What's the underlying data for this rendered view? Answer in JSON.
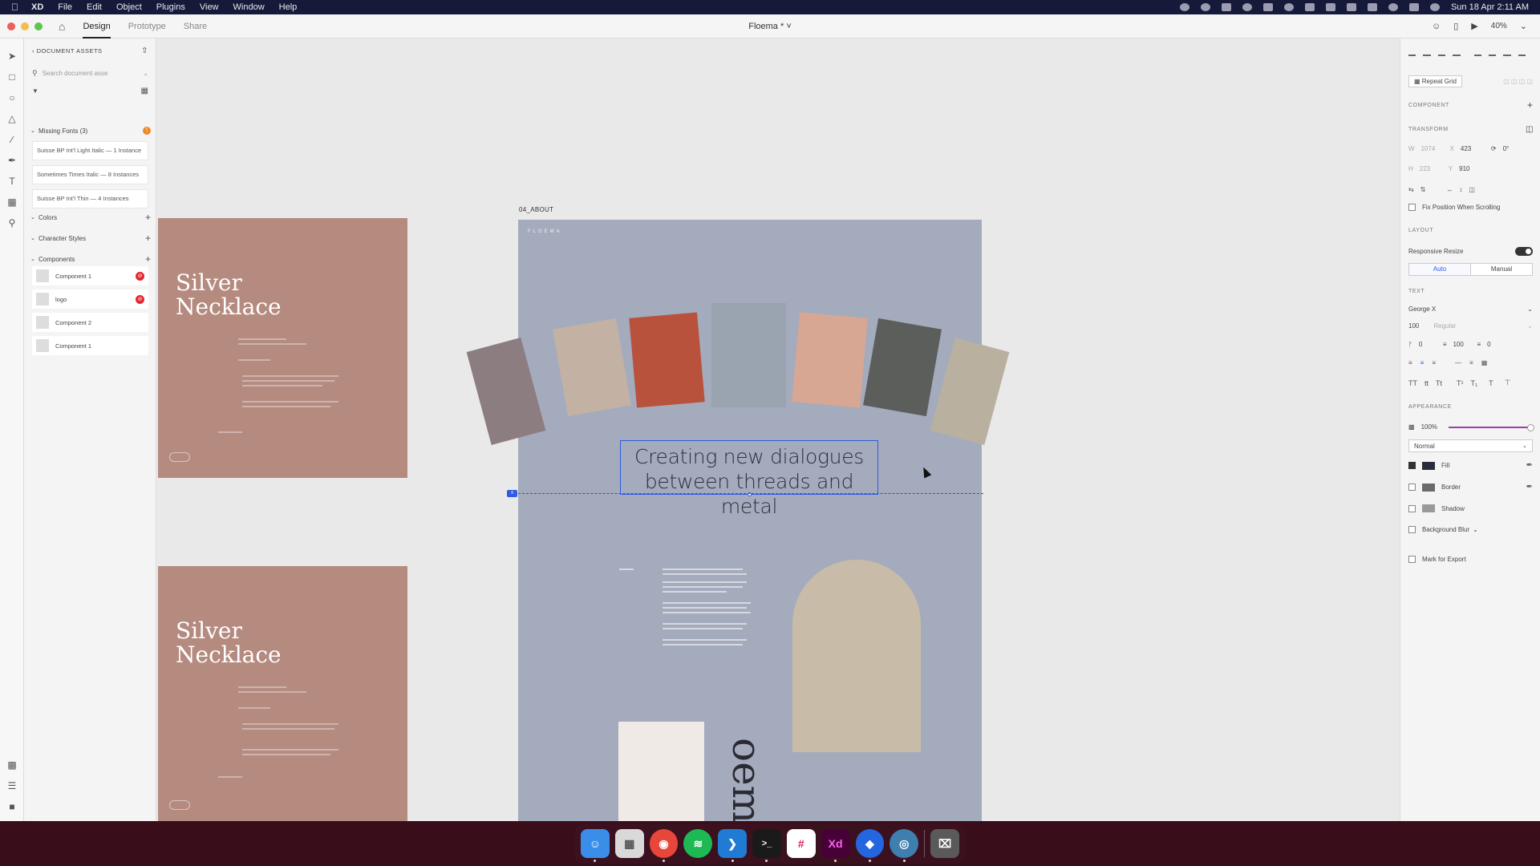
{
  "menubar": {
    "app_name": "XD",
    "items": [
      "File",
      "Edit",
      "Object",
      "Plugins",
      "View",
      "Window",
      "Help"
    ],
    "clock": "Sun 18 Apr  2:11 AM"
  },
  "titlebar": {
    "tabs": [
      {
        "label": "Design",
        "active": true
      },
      {
        "label": "Prototype",
        "active": false
      },
      {
        "label": "Share",
        "active": false
      }
    ],
    "doc_title": "Floema * ˅",
    "zoom": "40%"
  },
  "assets": {
    "header": "DOCUMENT ASSETS",
    "search_placeholder": "Search document asse",
    "missing_fonts": {
      "label": "Missing Fonts (3)",
      "badge": "!",
      "items": [
        "Suisse BP Int'l Light Italic — 1 Instance",
        "Sometimes Times Italic — 8 Instances",
        "Suisse BP Int'l Thin — 4 Instances"
      ]
    },
    "colors_label": "Colors",
    "character_styles_label": "Character Styles",
    "components_label": "Components",
    "components": [
      {
        "name": "Component 1",
        "broken": true
      },
      {
        "name": "logo",
        "broken": true
      },
      {
        "name": "Component 2",
        "broken": false
      },
      {
        "name": "Component 1",
        "broken": false
      }
    ]
  },
  "canvas": {
    "side_board_title": "Silver\nNecklace",
    "about_label": "04_ABOUT",
    "about_logo": "FLOEMA",
    "heading_line1": "Creating new dialogues",
    "heading_line2": "between threads and metal",
    "vertical_word": "oema",
    "about_bg": "#a4abbc",
    "side_bg": "#b58b80",
    "selection_color": "#2d5be3"
  },
  "inspector": {
    "repeat_grid": "Repeat Grid",
    "component_label": "COMPONENT",
    "transform_label": "TRANSFORM",
    "w_label": "W",
    "w_value": "1074",
    "h_label": "H",
    "h_value": "223",
    "x_label": "X",
    "x_value": "423",
    "y_label": "Y",
    "y_value": "910",
    "rotation": "0°",
    "fix_position": "Fix Position When Scrolling",
    "layout_label": "LAYOUT",
    "responsive_resize": "Responsive Resize",
    "seg_auto": "Auto",
    "seg_manual": "Manual",
    "text_label": "TEXT",
    "font_family": "George X",
    "font_size": "100",
    "font_weight": "Regular",
    "char_spacing": "0",
    "line_spacing": "100",
    "para_spacing": "0",
    "appearance_label": "APPEARANCE",
    "opacity": "100%",
    "blend_mode": "Normal",
    "fill_label": "Fill",
    "border_label": "Border",
    "shadow_label": "Shadow",
    "bg_blur_label": "Background Blur",
    "mark_export": "Mark for Export",
    "fill_color": "#2a2d3e"
  },
  "dock": {
    "apps": [
      {
        "name": "finder",
        "color": "#3b8ee8",
        "glyph": "☺"
      },
      {
        "name": "launchpad",
        "color": "#d9d9d9",
        "glyph": "▦"
      },
      {
        "name": "chrome",
        "color": "#e7473b",
        "glyph": "◉"
      },
      {
        "name": "spotify",
        "color": "#1db954",
        "glyph": "≋"
      },
      {
        "name": "vscode",
        "color": "#1f7bd3",
        "glyph": "❯"
      },
      {
        "name": "terminal",
        "color": "#1a1a1a",
        "glyph": ">_"
      },
      {
        "name": "slack",
        "color": "#ffffff",
        "glyph": "#"
      },
      {
        "name": "xd",
        "color": "#470137",
        "glyph": "Xd"
      },
      {
        "name": "vpn",
        "color": "#2466e0",
        "glyph": "◆"
      },
      {
        "name": "qbrowser",
        "color": "#3e7fb0",
        "glyph": "◎"
      },
      {
        "name": "trash",
        "color": "#5a5a5a",
        "glyph": "⌧"
      }
    ]
  }
}
